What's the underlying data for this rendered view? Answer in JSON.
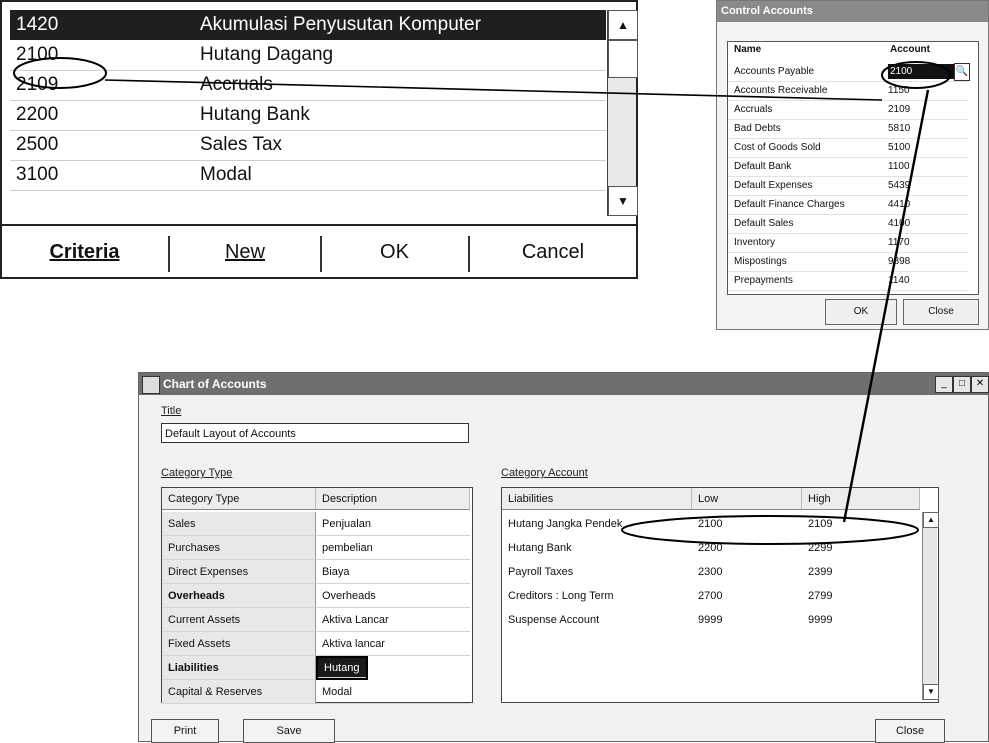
{
  "lookup": {
    "rows": [
      {
        "code": "1420",
        "name": "Akumulasi Penyusutan Komputer",
        "selected": true
      },
      {
        "code": "2100",
        "name": "Hutang Dagang",
        "selected": false
      },
      {
        "code": "2109",
        "name": "Accruals",
        "selected": false
      },
      {
        "code": "2200",
        "name": "Hutang Bank",
        "selected": false
      },
      {
        "code": "2500",
        "name": "Sales Tax",
        "selected": false
      },
      {
        "code": "3100",
        "name": "Modal",
        "selected": false
      }
    ],
    "buttons": {
      "criteria": "Criteria",
      "new": "New",
      "ok": "OK",
      "cancel": "Cancel"
    }
  },
  "control_accounts": {
    "title": "Control Accounts",
    "col_name": "Name",
    "col_account": "Account",
    "rows": [
      {
        "name": "Accounts Payable",
        "account": "2100",
        "editing": true
      },
      {
        "name": "Accounts Receivable",
        "account": "1150"
      },
      {
        "name": "Accruals",
        "account": "2109"
      },
      {
        "name": "Bad Debts",
        "account": "5810"
      },
      {
        "name": "Cost of Goods Sold",
        "account": "5100"
      },
      {
        "name": "Default Bank",
        "account": "1100"
      },
      {
        "name": "Default Expenses",
        "account": "5439"
      },
      {
        "name": "Default Finance Charges",
        "account": "4410"
      },
      {
        "name": "Default Sales",
        "account": "4100"
      },
      {
        "name": "Inventory",
        "account": "1170"
      },
      {
        "name": "Mispostings",
        "account": "9898"
      },
      {
        "name": "Prepayments",
        "account": "1140"
      }
    ],
    "buttons": {
      "ok": "OK",
      "close": "Close"
    }
  },
  "chart_of_accounts": {
    "window_title": "Chart of Accounts",
    "title_label": "Title",
    "title_value": "Default Layout of Accounts",
    "category_type_label": "Category Type",
    "category_account_label": "Category Account",
    "ct_headers": {
      "type": "Category Type",
      "desc": "Description"
    },
    "category_types": [
      {
        "type": "Sales",
        "desc": "Penjualan"
      },
      {
        "type": "Purchases",
        "desc": "pembelian"
      },
      {
        "type": "Direct Expenses",
        "desc": "Biaya"
      },
      {
        "type": "Overheads",
        "desc": "Overheads"
      },
      {
        "type": "Current Assets",
        "desc": "Aktiva Lancar"
      },
      {
        "type": "Fixed Assets",
        "desc": "Aktiva lancar"
      },
      {
        "type": "Liabilities",
        "desc": "Hutang",
        "active": true
      },
      {
        "type": "Capital & Reserves",
        "desc": "Modal"
      }
    ],
    "ca_headers": {
      "name": "Liabilities",
      "low": "Low",
      "high": "High"
    },
    "category_accounts": [
      {
        "name": "Hutang Jangka Pendek",
        "low": "2100",
        "high": "2109"
      },
      {
        "name": "Hutang Bank",
        "low": "2200",
        "high": "2299"
      },
      {
        "name": "Payroll Taxes",
        "low": "2300",
        "high": "2399"
      },
      {
        "name": "Creditors : Long Term",
        "low": "2700",
        "high": "2799"
      },
      {
        "name": "Suspense Account",
        "low": "9999",
        "high": "9999"
      }
    ],
    "buttons": {
      "print": "Print",
      "save": "Save",
      "close": "Close"
    }
  }
}
